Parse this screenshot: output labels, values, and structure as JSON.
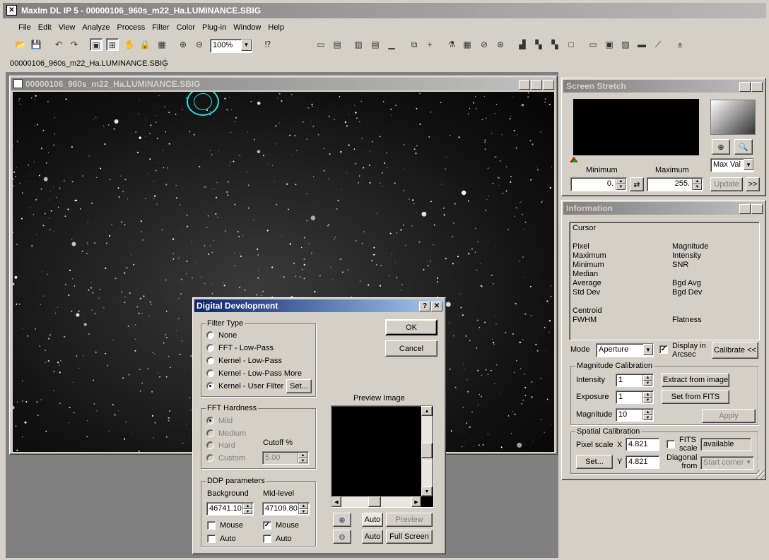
{
  "app": {
    "title": "MaxIm DL IP 5 - 00000106_960s_m22_Ha.LUMINANCE.SBIG"
  },
  "menu": [
    "File",
    "Edit",
    "View",
    "Analyze",
    "Process",
    "Filter",
    "Color",
    "Plug-in",
    "Window",
    "Help"
  ],
  "toolbar": {
    "zoom": "100%"
  },
  "tab": {
    "label": "00000106_960s_m22_Ha.LUMINANCE.SBIG"
  },
  "image_window": {
    "title": "00000106_960s_m22_Ha.LUMINANCE.SBIG"
  },
  "screen_stretch": {
    "title": "Screen Stretch",
    "min_label": "Minimum",
    "max_label": "Maximum",
    "min_value": "0.",
    "max_value": "255.",
    "mode": "Max Val",
    "update": "Update",
    "more": ">>"
  },
  "information": {
    "title": "Information",
    "cursor": "Cursor",
    "left": [
      "Pixel",
      "Maximum",
      "Minimum",
      "Median",
      "Average",
      "Std Dev",
      "",
      "Centroid",
      "FWHM"
    ],
    "right": [
      "Magnitude",
      "Intensity",
      "SNR",
      "",
      "Bgd Avg",
      "Bgd Dev",
      "",
      "",
      "Flatness"
    ],
    "mode_label": "Mode",
    "mode_value": "Aperture",
    "display_arcsec": "Display in\nArcsec",
    "calibrate": "Calibrate <<",
    "mag_cal": {
      "title": "Magnitude Calibration",
      "intensity_label": "Intensity",
      "intensity": "1",
      "exposure_label": "Exposure",
      "exposure": "1",
      "magnitude_label": "Magnitude",
      "magnitude": "10",
      "extract": "Extract from image",
      "set_fits": "Set from FITS",
      "apply": "Apply"
    },
    "spatial": {
      "title": "Spatial Calibration",
      "pixel_scale": "Pixel scale",
      "x_label": "X",
      "x": "4.821",
      "y_label": "Y",
      "y": "4.821",
      "fits_scale": "FITS\nscale",
      "available": "available",
      "diagonal": "Diagonal\nfrom",
      "start_corner": "Start corner",
      "set": "Set..."
    }
  },
  "ddp": {
    "title": "Digital Development",
    "ok": "OK",
    "cancel": "Cancel",
    "filter_type": "Filter Type",
    "filters": [
      "None",
      "FFT - Low-Pass",
      "Kernel - Low-Pass",
      "Kernel - Low-Pass More",
      "Kernel - User Filter"
    ],
    "set": "Set...",
    "fft_hardness": "FFT Hardness",
    "hardness": [
      "Mild",
      "Medium",
      "Hard",
      "Custom"
    ],
    "cutoff_label": "Cutoff %",
    "cutoff": "5.00",
    "params": "DDP parameters",
    "background_label": "Background",
    "background": "46741.10",
    "midlevel_label": "Mid-level",
    "midlevel": "47109.80",
    "mouse": "Mouse",
    "auto": "Auto",
    "preview_label": "Preview Image",
    "auto_btn": "Auto",
    "preview_btn": "Preview",
    "full_screen": "Full Screen"
  }
}
